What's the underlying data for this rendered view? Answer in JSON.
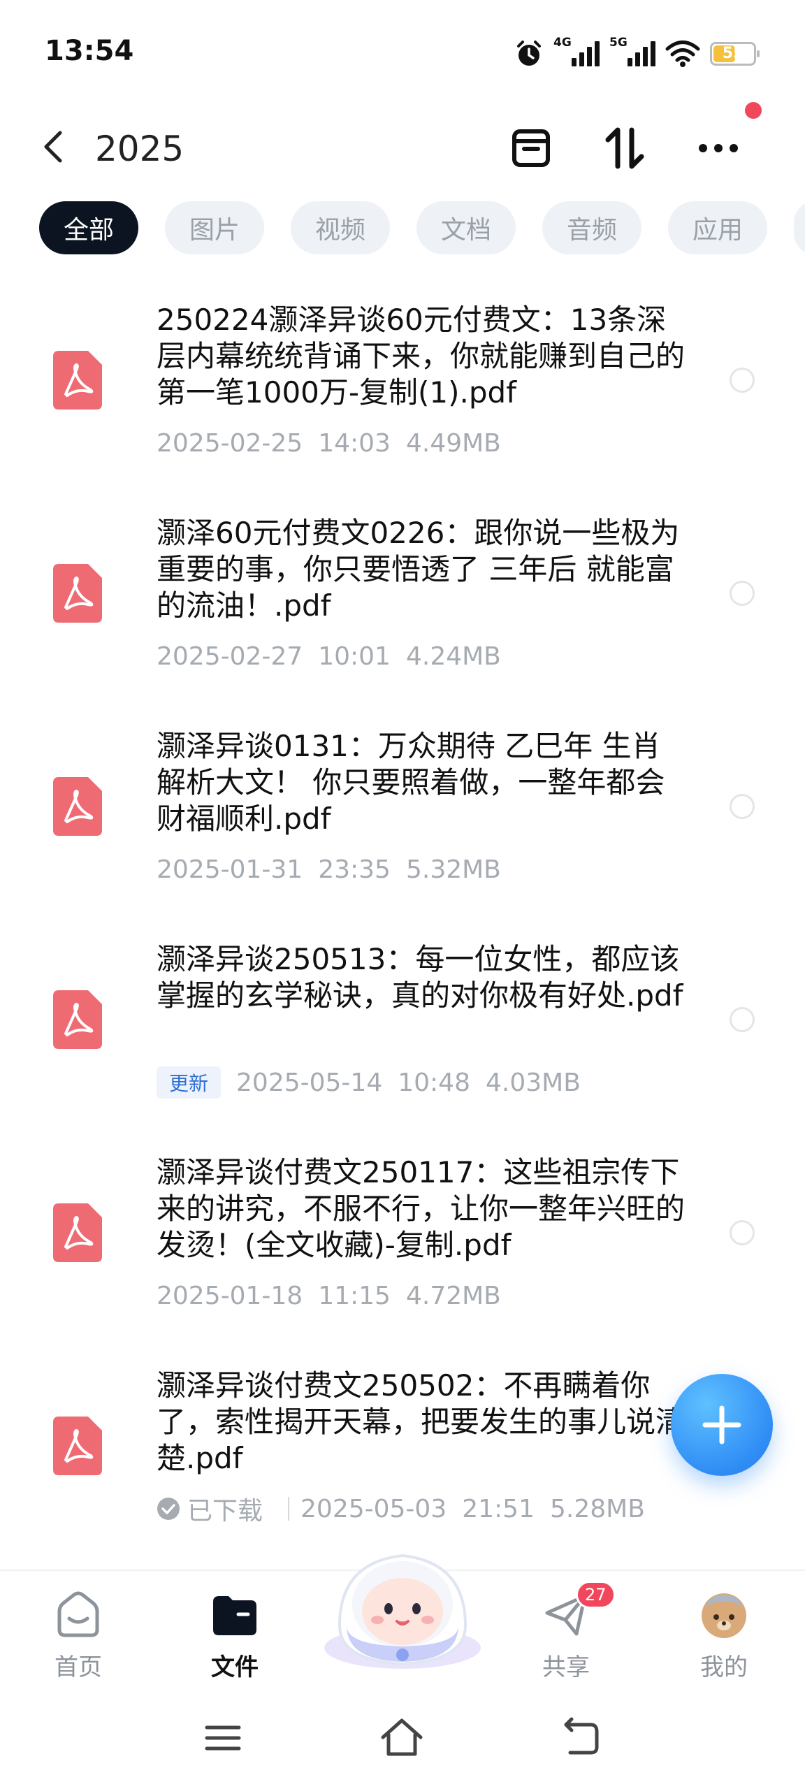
{
  "status_bar": {
    "time": "13:54",
    "net1": "4G",
    "net2": "5G",
    "battery": "55",
    "battery_level": 0.55
  },
  "header": {
    "title": "2025"
  },
  "tabs": [
    {
      "label": "全部",
      "active": true
    },
    {
      "label": "图片"
    },
    {
      "label": "视频"
    },
    {
      "label": "文档"
    },
    {
      "label": "音频"
    },
    {
      "label": "应用"
    }
  ],
  "files": [
    {
      "name": "250224灏泽异谈60元付费文：13条深层内幕统统背诵下来，你就能赚到自己的第一笔1000万-复制(1).pdf",
      "date": "2025-02-25",
      "time": "14:03",
      "size": "4.49MB"
    },
    {
      "name": "灏泽60元付费文0226：跟你说一些极为重要的事，你只要悟透了 三年后 就能富的流油！.pdf",
      "date": "2025-02-27",
      "time": "10:01",
      "size": "4.24MB"
    },
    {
      "name": "灏泽异谈0131：万众期待 乙巳年 生肖解析大文！ 你只要照着做，一整年都会财福顺利.pdf",
      "date": "2025-01-31",
      "time": "23:35",
      "size": "5.32MB"
    },
    {
      "name": "灏泽异谈250513：每一位女性，都应该掌握的玄学秘诀，真的对你极有好处.pdf",
      "badge": "更新",
      "date": "2025-05-14",
      "time": "10:48",
      "size": "4.03MB"
    },
    {
      "name": "灏泽异谈付费文250117：这些祖宗传下来的讲究，不服不行，让你一整年兴旺的发烫！(全文收藏)-复制.pdf",
      "date": "2025-01-18",
      "time": "11:15",
      "size": "4.72MB"
    },
    {
      "name": "灏泽异谈付费文250502：不再瞒着你了，索性揭开天幕，把要发生的事儿说清楚.pdf",
      "status": "已下载",
      "date": "2025-05-03",
      "time": "21:51",
      "size": "5.28MB"
    }
  ],
  "bottom_nav": {
    "home": "首页",
    "files": "文件",
    "share": "共享",
    "share_badge": "27",
    "mine": "我的"
  },
  "colors": {
    "accent": "#2f8df5",
    "pdf_red": "#ee6b73",
    "badge_red": "#f1475c",
    "active_tab": "#0b1420"
  }
}
